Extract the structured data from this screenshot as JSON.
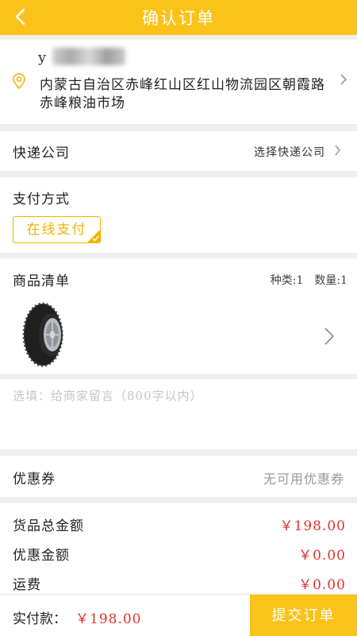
{
  "header": {
    "title": "确认订单",
    "back_icon": "chevron-left-icon"
  },
  "address": {
    "name": "y",
    "text": "内蒙古自治区赤峰红山区红山物流园区朝霞路赤峰粮油市场",
    "icon": "location-pin-icon"
  },
  "express": {
    "label": "快递公司",
    "value": "选择快递公司"
  },
  "payment": {
    "label": "支付方式",
    "option": "在线支付"
  },
  "goods": {
    "label": "商品清单",
    "kinds": "种类:1",
    "quantity": "数量:1",
    "item_image": "tire-image"
  },
  "memo": {
    "placeholder": "选填：给商家留言（800字以内）",
    "value": ""
  },
  "coupon": {
    "label": "优惠券",
    "value": "无可用优惠券"
  },
  "totals": [
    {
      "label": "货品总金额",
      "amount": "￥198.00"
    },
    {
      "label": "优惠金额",
      "amount": "￥0.00"
    },
    {
      "label": "运费",
      "amount": "￥0.00"
    }
  ],
  "footer": {
    "pay_label": "实付款：",
    "pay_amount": "￥198.00",
    "submit": "提交订单"
  },
  "colors": {
    "accent": "#fbc219",
    "price": "#e0322c",
    "pay_option": "#f0b400"
  }
}
